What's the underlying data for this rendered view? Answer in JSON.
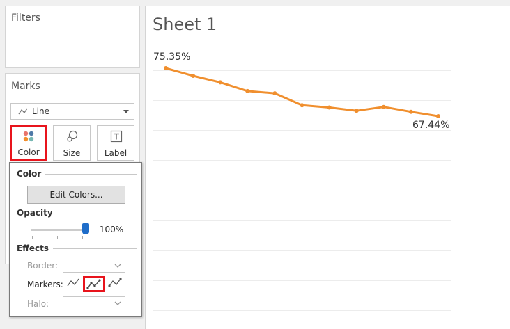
{
  "filters": {
    "title": "Filters"
  },
  "marks": {
    "title": "Marks",
    "mark_type": "Line",
    "buttons": {
      "color": "Color",
      "size": "Size",
      "label": "Label"
    }
  },
  "color_popup": {
    "color_section": "Color",
    "edit_colors": "Edit Colors...",
    "opacity_section": "Opacity",
    "opacity_value": "100%",
    "opacity": 1.0,
    "effects_section": "Effects",
    "border_label": "Border:",
    "markers_label": "Markers:",
    "halo_label": "Halo:",
    "selected_marker_option": "all"
  },
  "sheet": {
    "title": "Sheet 1"
  },
  "colors": {
    "line": "#f08f2e",
    "highlight": "#e8141c",
    "slider": "#1f6dc9"
  },
  "chart_data": {
    "type": "line",
    "x": [
      1,
      2,
      3,
      4,
      5,
      6,
      7,
      8,
      9,
      10,
      11
    ],
    "values": [
      75.35,
      74.65,
      74.05,
      73.25,
      73.05,
      71.95,
      71.75,
      71.45,
      71.8,
      71.35,
      70.95
    ],
    "labels": {
      "first": "75.35%",
      "last": "67.44%"
    },
    "markers": "all",
    "grid": true
  }
}
